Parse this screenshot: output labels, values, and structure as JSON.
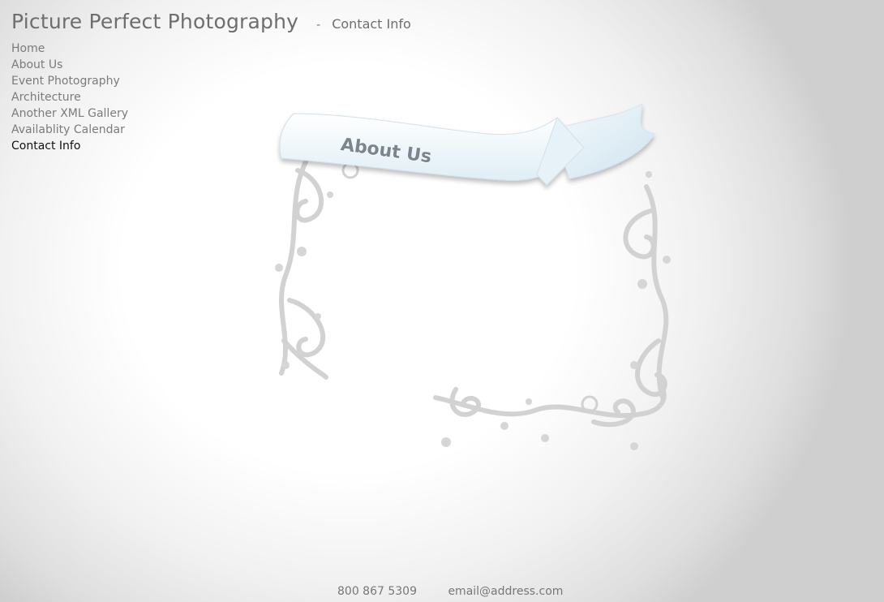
{
  "header": {
    "site_title": "Picture Perfect Photography",
    "separator": "-",
    "current_page": "Contact Info"
  },
  "nav": {
    "items": [
      {
        "label": "Home",
        "active": false
      },
      {
        "label": "About Us",
        "active": false
      },
      {
        "label": "Event Photography",
        "active": false
      },
      {
        "label": "Architecture",
        "active": false
      },
      {
        "label": "Another XML Gallery",
        "active": false
      },
      {
        "label": "Availablity Calendar",
        "active": false
      },
      {
        "label": "Contact Info",
        "active": true
      }
    ]
  },
  "content": {
    "banner_label": "About Us"
  },
  "footer": {
    "phone": "800 867 5309",
    "email": "email@address.com"
  },
  "colors": {
    "nav_text": "#7b7b7b",
    "nav_active": "#111111",
    "ornament": "#cfcfcf"
  }
}
